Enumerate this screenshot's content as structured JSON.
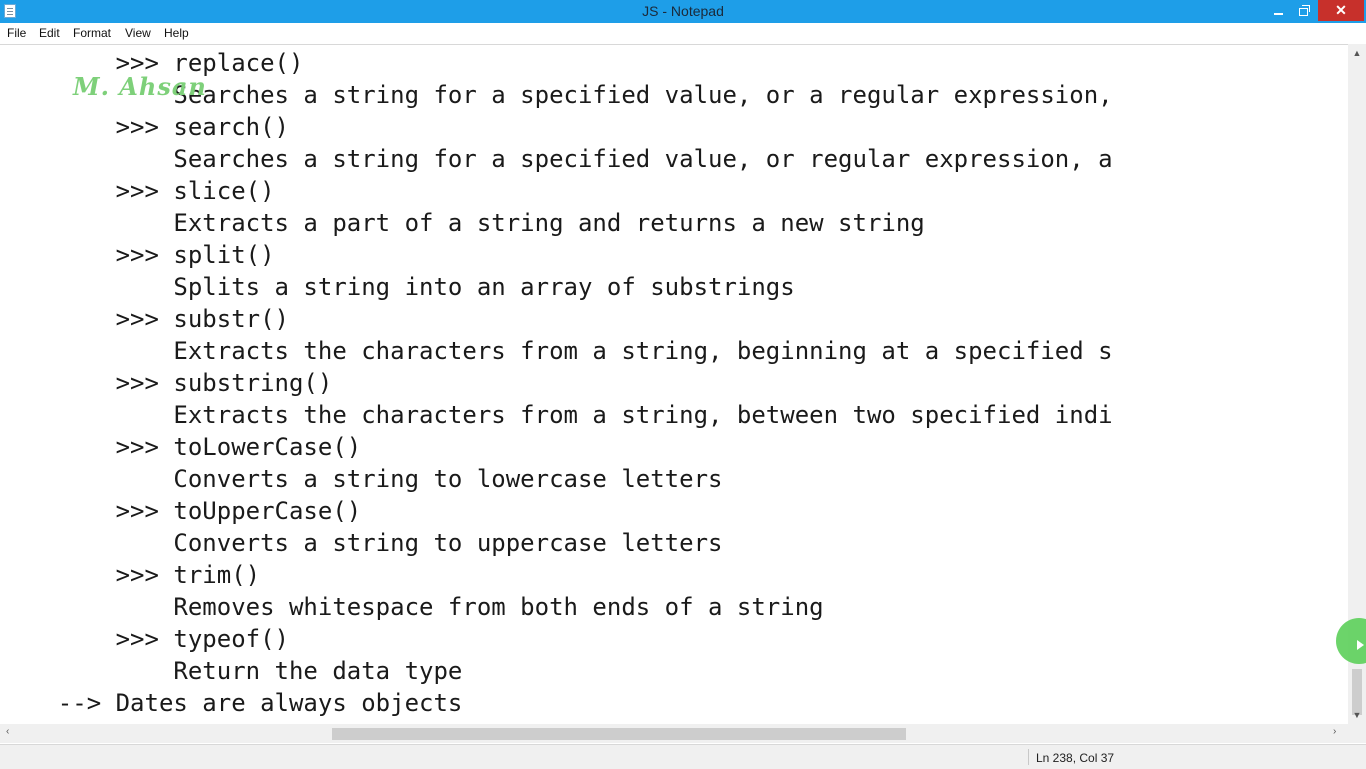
{
  "window": {
    "title": "JS - Notepad",
    "min_icon": "minimize-icon",
    "max_icon": "restore-icon",
    "close_label": "✕"
  },
  "menu": [
    "File",
    "Edit",
    "Format",
    "View",
    "Help"
  ],
  "watermark": "M. Ahsan",
  "editor": {
    "lines": [
      "        >>> replace()",
      "            Searches a string for a specified value, or a regular expression,",
      "        >>> search()",
      "            Searches a string for a specified value, or regular expression, a",
      "        >>> slice()",
      "            Extracts a part of a string and returns a new string",
      "        >>> split()",
      "            Splits a string into an array of substrings",
      "        >>> substr()",
      "            Extracts the characters from a string, beginning at a specified s",
      "        >>> substring()",
      "            Extracts the characters from a string, between two specified indi",
      "        >>> toLowerCase()",
      "            Converts a string to lowercase letters",
      "        >>> toUpperCase()",
      "            Converts a string to uppercase letters",
      "        >>> trim()",
      "            Removes whitespace from both ends of a string",
      "        >>> typeof()",
      "            Return the data type",
      "    --> Dates are always objects"
    ]
  },
  "scroll": {
    "up": "▲",
    "down": "▼",
    "left": "‹",
    "right": "›"
  },
  "status": {
    "position": "Ln 238, Col 37"
  },
  "colors": {
    "titlebar": "#1e9ee8",
    "close": "#c7302b",
    "watermark": "#7ed07a",
    "cursor_highlight": "#5ccf5a"
  }
}
